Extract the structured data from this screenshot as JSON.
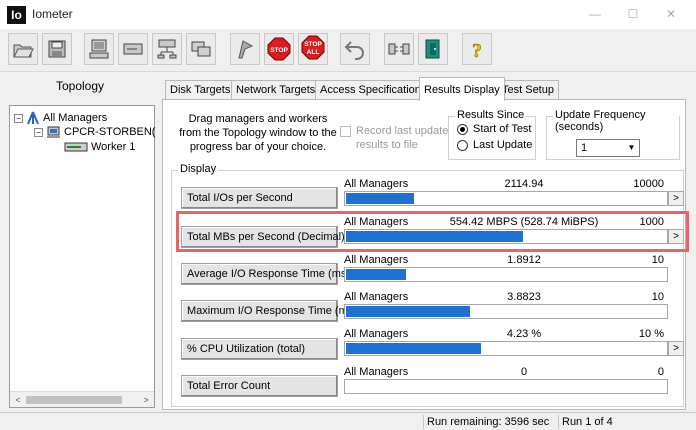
{
  "window": {
    "title": "Iometer",
    "app_icon_text": "Io"
  },
  "toolbar": {
    "stop_label": "STOP",
    "stop_all_label_top": "STOP",
    "stop_all_label_bottom": "ALL",
    "help_label": "?"
  },
  "topology": {
    "label": "Topology",
    "tree": [
      {
        "expander": "−",
        "label": "All Managers"
      },
      {
        "expander": "−",
        "label": "CPCR-STORBEN("
      },
      {
        "expander": "",
        "label": "Worker 1"
      }
    ]
  },
  "tabs": [
    {
      "label": "Disk Targets",
      "active": false
    },
    {
      "label": "Network Targets",
      "active": false
    },
    {
      "label": "Access Specifications",
      "active": false
    },
    {
      "label": "Results Display",
      "active": true
    },
    {
      "label": "Test Setup",
      "active": false
    }
  ],
  "results": {
    "drag_text": "Drag managers and workers from the Topology window to the progress bar of your choice.",
    "record_label": "Record last update results to file",
    "results_since": {
      "title": "Results Since",
      "option_start": "Start of Test",
      "option_last": "Last Update",
      "selected": "start"
    },
    "update_frequency": {
      "title": "Update Frequency (seconds)",
      "value": "1"
    },
    "display_title": "Display",
    "metrics": [
      {
        "label": "Total I/Os per Second",
        "manager": "All Managers",
        "value": "2114.94",
        "max": "10000",
        "fill": 0.211
      },
      {
        "label": "Total MBs per Second (Decimal)",
        "manager": "All Managers",
        "value": "554.42 MBPS (528.74 MiBPS)",
        "max": "1000",
        "fill": 0.554
      },
      {
        "label": "Average I/O Response Time (ms)",
        "manager": "All Managers",
        "value": "1.8912",
        "max": "10",
        "fill": 0.189
      },
      {
        "label": "Maximum I/O Response Time (ms)",
        "manager": "All Managers",
        "value": "3.8823",
        "max": "10",
        "fill": 0.388
      },
      {
        "label": "% CPU Utilization (total)",
        "manager": "All Managers",
        "value": "4.23 %",
        "max": "10 %",
        "fill": 0.423
      },
      {
        "label": "Total Error Count",
        "manager": "All Managers",
        "value": "0",
        "max": "0",
        "fill": 0
      }
    ]
  },
  "status": {
    "run_remaining": "Run remaining: 3596 sec",
    "run_of": "Run 1 of 4"
  }
}
